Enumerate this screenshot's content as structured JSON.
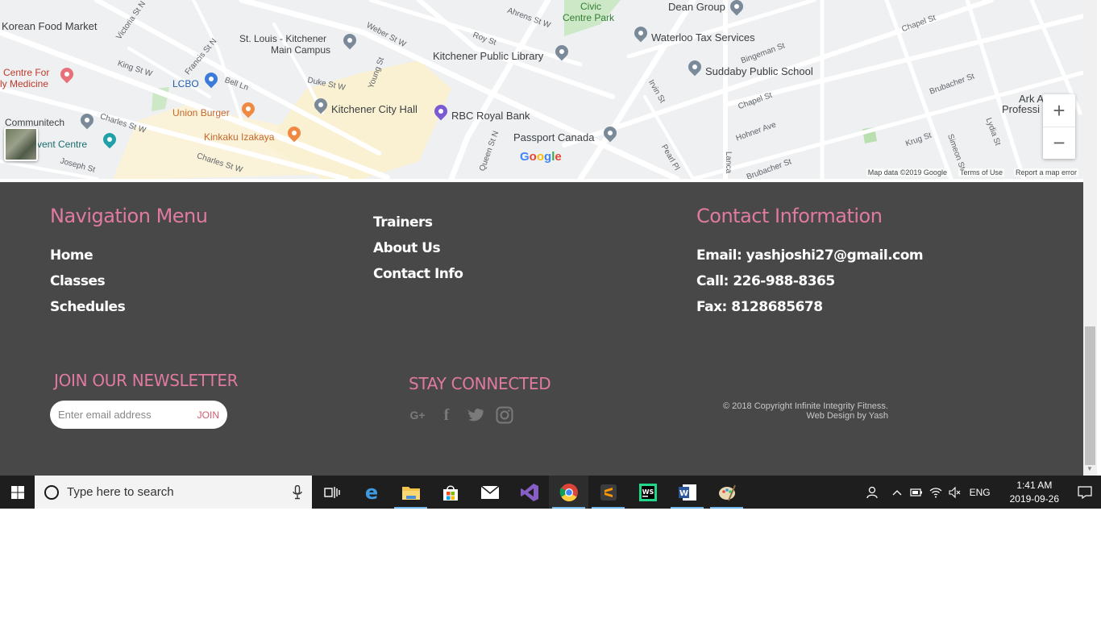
{
  "map": {
    "labels": {
      "korean_food_market": "Korean Food Market",
      "centre_for_medicine_1": "Centre For",
      "centre_for_medicine_2": "ly Medicine",
      "lcbo": "LCBO",
      "union_burger": "Union Burger",
      "kinkaku": "Kinkaku Izakaya",
      "communitech": "Communitech",
      "event_centre": "Event Centre",
      "st_louis_1": "St. Louis - Kitchener",
      "st_louis_2": "Main Campus",
      "kitchener_city_hall": "Kitchener City Hall",
      "kitchener_public_library": "Kitchener Public Library",
      "rbc_royal_bank": "RBC Royal Bank",
      "passport_canada": "Passport Canada",
      "civic_centre_park_1": "Civic",
      "civic_centre_park_2": "Centre Park",
      "dean_group": "Dean Group",
      "waterloo_tax_services": "Waterloo Tax Services",
      "suddaby_public_school": "Suddaby Public School",
      "ark_1": "Ark A",
      "ark_2": "Professi",
      "victoria_st_n": "Victoria St N",
      "weber_st_w": "Weber St W",
      "king_st_w": "King St W",
      "duke_st_w": "Duke St W",
      "charles_st_w_1": "Charles St W",
      "charles_st_w_2": "Charles St W",
      "joseph_st": "Joseph St",
      "bell_ln": "Bell Ln",
      "francis_st_n": "Francis St N",
      "young_st": "Young St",
      "queen_st_n": "Queen St N",
      "roy_st": "Roy St",
      "ahrens_st_w": "Ahrens St W",
      "irvin_st": "Irvin St",
      "pearl_pl": "Pearl Pl",
      "lancaster": "Lanca",
      "chapel_st_1": "Chapel St",
      "chapel_st_2": "Chapel St",
      "bingeman_st": "Bingeman St",
      "brubacher_st_1": "Brubacher St",
      "brubacher_st_2": "Brubacher St",
      "hohner_ave": "Hohner Ave",
      "krug_st": "Krug St",
      "simeon_st": "Simeon St",
      "lydia_st": "Lydia St"
    },
    "zoom_in": "+",
    "zoom_out": "−",
    "google": "Google",
    "map_data": "Map data ©2019 Google",
    "terms": "Terms of Use",
    "report": "Report a map error"
  },
  "footer": {
    "nav_heading": "Navigation Menu",
    "nav_col1": [
      "Home",
      "Classes",
      "Schedules"
    ],
    "nav_col2": [
      "Trainers",
      "About Us",
      "Contact Info"
    ],
    "contact_heading": "Contact Information",
    "email": "Email: yashjoshi27@gmail.com",
    "call": "Call: 226-988-8365",
    "fax": "Fax: 8128685678",
    "newsletter_heading": "JOIN OUR NEWSLETTER",
    "newsletter_placeholder": "Enter email address",
    "newsletter_button": "JOIN",
    "stay_connected": "STAY CONNECTED",
    "social_icons": [
      "google-plus-icon",
      "facebook-icon",
      "twitter-icon",
      "instagram-icon"
    ],
    "social_glyphs": [
      "G+",
      "f",
      "t",
      "◎"
    ],
    "copyright_line1": "© 2018 Copyright Infinite Integrity Fitness.",
    "copyright_line2": "Web Design by Yash",
    "colors": {
      "background": "#484848",
      "accent": "#e07aa0",
      "link": "#ffffff"
    }
  },
  "taskbar": {
    "search_placeholder": "Type here to search",
    "apps": [
      "task-view",
      "edge",
      "file-explorer",
      "store",
      "mail",
      "visual-studio",
      "chrome",
      "sublime-text",
      "webstorm",
      "word",
      "paint"
    ],
    "language": "ENG",
    "time": "1:41 AM",
    "date": "2019-09-26"
  }
}
